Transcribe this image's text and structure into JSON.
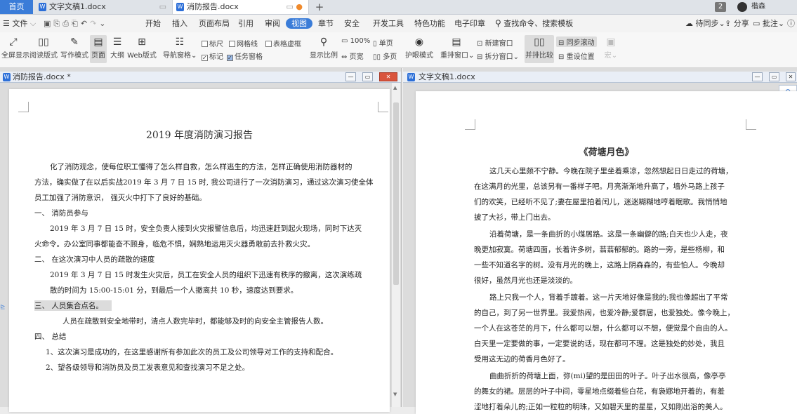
{
  "tabs": {
    "home": "首页",
    "doc1": "文字文稿1.docx",
    "doc2": "消防报告.docx",
    "count_badge": "2",
    "username": "楷森"
  },
  "menu": {
    "file": "文件",
    "items": [
      "开始",
      "插入",
      "页面布局",
      "引用",
      "审阅",
      "视图",
      "章节",
      "安全",
      "开发工具",
      "特色功能",
      "电子印章"
    ],
    "search_placeholder": "查找命令、搜索模板",
    "right": [
      "待同步",
      "分享",
      "批注"
    ]
  },
  "ribbon": {
    "fullscreen": "全屏显示",
    "reading": "阅读版式",
    "writing": "写作模式",
    "page": "页面",
    "outline": "大纲",
    "web": "Web版式",
    "nav": "导航窗格",
    "ruler": "标尺",
    "gridlines": "网格线",
    "table_lines": "表格虚框",
    "markers": "标记",
    "task_pane": "任务窗格",
    "zoom": "显示比例",
    "zoom_100": "100%",
    "single_page": "单页",
    "page_width": "页宽",
    "multi_page": "多页",
    "eye_mode": "护眼模式",
    "rearrange": "重排窗口",
    "new_window": "新建窗口",
    "split_window": "拆分窗口",
    "side_by_side": "并排比较",
    "sync_scroll": "同步滚动",
    "reset_position": "重设位置",
    "macro": "宏"
  },
  "left_window": {
    "title": "消防报告.docx *",
    "doc_title": "2019 年度消防演习报告",
    "lines": [
      "化了消防观念，使每位职工懂得了怎么样自救，怎么样逃生的方法，怎样正确使用消防器材的",
      "方法，确实做了在以后实战2019 年 3 月 7 日 15 时, 我公司进行了一次消防演习，通过这次演习使全体",
      "员工加强了消防意识， 强灭火中打下了良好的基础。",
      "一、  消防员参与",
      "2019 年 3 月 7 日 15 时，安全负责人接到火灾报警信息后，均迅速赶到起火现场，同时下达灭",
      "火命令。办公室同事都能奋不顾身，临危不惧，娴熟地运用灭火器勇敢前去扑救火灾。",
      "二、  在这次演习中人员的疏散的速度",
      "2019 年 3 月 7 日 15 时发生火灾后，员工在安全人员的组织下迅速有秩序的撤离，这次演练疏",
      "散的时间为 15:00-15:01 分，到最后一个人撤离共 10 秒，速度达到要求。",
      "三、  人员集合点名。",
      "人员在疏散到安全地带时，清点人数完毕时，都能够及时的向安全主管报告人数。",
      "四、  总结",
      "1、这次演习是成功的，在这里感谢所有参加此次的员工及公司领导对工作的支持和配合。",
      "2、望各级领导和消防员及员工发表意见和查找演习不足之处。"
    ]
  },
  "right_window": {
    "title": "文字文稿1.docx",
    "doc_title": "《荷塘月色》",
    "lines": [
      "这几天心里颇不宁静。今晚在院子里坐着乘凉，忽然想起日日走过的荷塘，",
      "在这满月的光里，总该另有一番样子吧。月亮渐渐地升高了，墙外马路上孩子",
      "们的欢笑，已经听不见了;妻在屋里拍着闰儿，迷迷糊糊地哼着眠歌。我悄悄地",
      "披了大衫，带上门出去。",
      "沿着荷塘，是一条曲折的小煤屑路。这是一条幽僻的路;白天也少人走，夜",
      "晚更加寂寞。荷塘四面，长着许多树，蓊蓊郁郁的。路的一旁，是些杨柳，和",
      "一些不知道名字的树。没有月光的晚上，这路上阴森森的，有些怕人。今晚却",
      "很好，虽然月光也还是淡淡的。",
      "路上只我一个人，背着手踱着。这一片天地好像是我的;我也像超出了平常",
      "的自己，到了另一世界里。我爱热闹，也爱冷静;爱群居，也爱独处。像今晚上，",
      "一个人在这苍茫的月下，什么都可以想，什么都可以不想，便觉是个自由的人。",
      "白天里一定要做的事，一定要说的话，现在都可不理。这是独处的妙处，我且",
      "受用这无边的荷香月色好了。",
      "曲曲折折的荷塘上面，弥(mi)望的是田田的叶子。叶子出水很高，像亭亭",
      "的舞女的裙。层层的叶子中间，零星地点缀着些白花，有袅娜地开着的，有羞",
      "涩地打着朵儿的;正如一粒粒的明珠，又如碧天里的星星，又如刚出浴的美人。"
    ]
  },
  "colors": {
    "accent": "#3a7cd8",
    "close": "#d9543d",
    "highlight": "#dcdcdc"
  }
}
